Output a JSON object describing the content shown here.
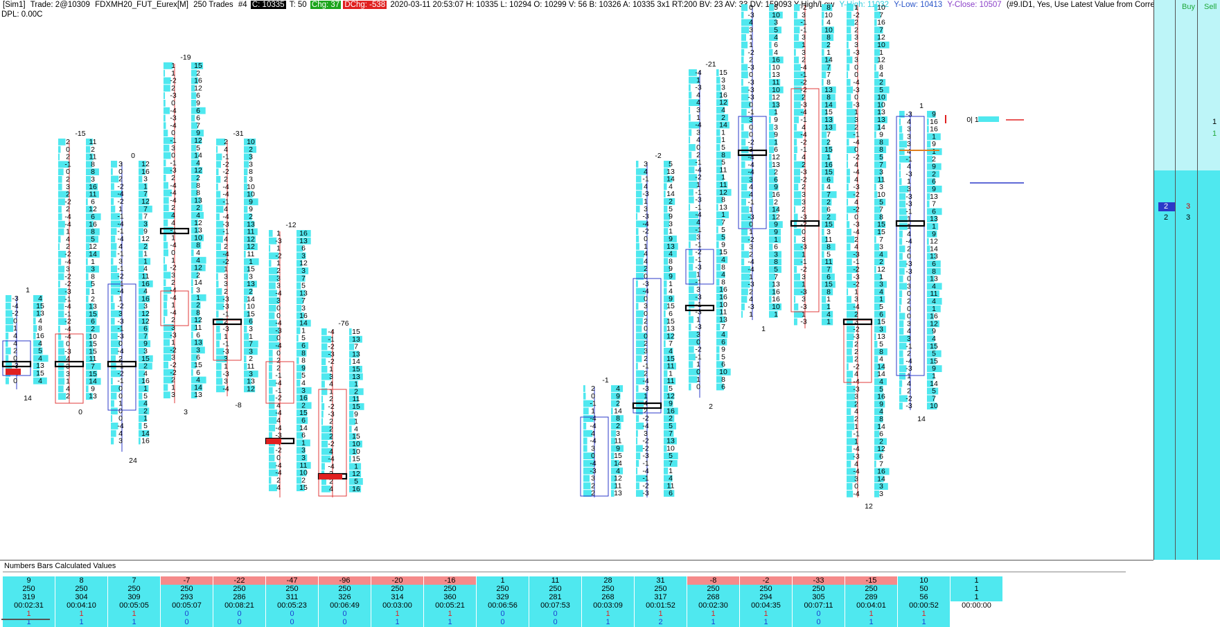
{
  "info_bar": {
    "account": "[Sim1]",
    "trade": "Trade: 2@10309",
    "symbol": "FDXMH20_FUT_Eurex[M]",
    "bar_type": "250 Trades",
    "instance": "#4",
    "close": "C: 10335",
    "trades": "T: 50",
    "change": "Chg: 37",
    "daily_change": "DChg: -538",
    "stats": "2020-03-11 20:53:07 H: 10335 L: 10294 O: 10299 V: 56 B: 10326 A: 10335 3x1 RT:200 BV: 23 AV: 33 DV: 159093 Y-High/Low",
    "y_high": "Y-High: 11032",
    "y_low": "Y-Low: 10413",
    "y_close": "Y-Close: 10507",
    "study_note": "(#9.ID1, Yes, Use Latest Value from Corresponding T"
  },
  "dpl": "DPL: 0.00C",
  "colors": {
    "bid_ask_bar": "#4fe8ef",
    "down_box": "#e23b3b",
    "up_box": "#2b39c8",
    "poc_outline": "#000000",
    "neg_row_bg": "#f58a8a",
    "pos_row_bg": "#4fe8ef"
  },
  "side_panel": {
    "headers": [
      "Buy",
      "Sell"
    ],
    "light_values": [
      {
        "col": 2,
        "text": "1"
      },
      {
        "col": 2,
        "text": "1"
      }
    ],
    "price_row": {
      "text1": "2",
      "text2": "3",
      "text3": "2",
      "text4": "3"
    },
    "open_label": "0| 1"
  },
  "candle_labels": {
    "top": [
      "1",
      "-15",
      "0",
      "-19",
      "-31",
      "-12",
      "-76",
      "-1",
      "-2",
      "-21",
      "1"
    ],
    "bottom": [
      "14",
      "0",
      "24",
      "3",
      "-8",
      "2",
      "1",
      "12",
      "14"
    ]
  },
  "bottom_panel": {
    "title": "Numbers Bars Calculated Values",
    "columns": [
      {
        "delta": "9",
        "trades": "250",
        "volume": "319",
        "time": "00:02:31",
        "r4": "1",
        "r5": "1"
      },
      {
        "delta": "8",
        "trades": "250",
        "volume": "304",
        "time": "00:04:10",
        "r4": "1",
        "r5": "1"
      },
      {
        "delta": "7",
        "trades": "250",
        "volume": "309",
        "time": "00:05:05",
        "r4": "1",
        "r5": "1"
      },
      {
        "delta": "-7",
        "trades": "250",
        "volume": "293",
        "time": "00:05:07",
        "r4": "0",
        "r5": "0"
      },
      {
        "delta": "-22",
        "trades": "250",
        "volume": "286",
        "time": "00:08:21",
        "r4": "0",
        "r5": "0"
      },
      {
        "delta": "-47",
        "trades": "250",
        "volume": "311",
        "time": "00:05:23",
        "r4": "0",
        "r5": "0"
      },
      {
        "delta": "-96",
        "trades": "250",
        "volume": "326",
        "time": "00:06:49",
        "r4": "0",
        "r5": "0"
      },
      {
        "delta": "-20",
        "trades": "250",
        "volume": "314",
        "time": "00:03:00",
        "r4": "1",
        "r5": "1"
      },
      {
        "delta": "-16",
        "trades": "250",
        "volume": "360",
        "time": "00:05:21",
        "r4": "1",
        "r5": "1"
      },
      {
        "delta": "1",
        "trades": "250",
        "volume": "329",
        "time": "00:06:56",
        "r4": "0",
        "r5": "0"
      },
      {
        "delta": "11",
        "trades": "250",
        "volume": "281",
        "time": "00:07:53",
        "r4": "0",
        "r5": "0"
      },
      {
        "delta": "28",
        "trades": "250",
        "volume": "268",
        "time": "00:03:09",
        "r4": "1",
        "r5": "1"
      },
      {
        "delta": "31",
        "trades": "250",
        "volume": "317",
        "time": "00:01:52",
        "r4": "1",
        "r5": "2"
      },
      {
        "delta": "-8",
        "trades": "250",
        "volume": "268",
        "time": "00:02:30",
        "r4": "1",
        "r5": "1"
      },
      {
        "delta": "-2",
        "trades": "250",
        "volume": "294",
        "time": "00:04:35",
        "r4": "1",
        "r5": "1"
      },
      {
        "delta": "-33",
        "trades": "250",
        "volume": "305",
        "time": "00:07:11",
        "r4": "0",
        "r5": "0"
      },
      {
        "delta": "-15",
        "trades": "250",
        "volume": "289",
        "time": "00:04:01",
        "r4": "1",
        "r5": "1"
      },
      {
        "delta": "10",
        "trades": "50",
        "volume": "56",
        "time": "00:00:52",
        "r4": "1",
        "r5": "1"
      },
      {
        "delta": "1",
        "trades": "1",
        "volume": "1",
        "time": "00:00:00",
        "r4": "",
        "r5": ""
      }
    ]
  },
  "chart_data": {
    "type": "table",
    "title": "",
    "bars": [
      {
        "label_top": "1",
        "label_bottom": "14",
        "delta": "9"
      },
      {
        "label_top": "-15",
        "label_bottom": "0",
        "delta": "8"
      },
      {
        "label_top": "0",
        "label_bottom": "24",
        "delta": "7"
      },
      {
        "label_top": "-19",
        "label_bottom": "3",
        "delta": "-7"
      },
      {
        "label_top": "-31",
        "label_bottom": "-8",
        "delta": "-22"
      },
      {
        "label_top": "-12",
        "label_bottom": "",
        "delta": "-47"
      },
      {
        "label_top": "-76",
        "label_bottom": "",
        "delta": "-96"
      },
      {
        "label_top": "",
        "label_bottom": "",
        "delta": "-20"
      },
      {
        "label_top": "",
        "label_bottom": "",
        "delta": "-16"
      },
      {
        "label_top": "",
        "label_bottom": "",
        "delta": "1"
      },
      {
        "label_top": "-1",
        "label_bottom": "",
        "delta": "11"
      },
      {
        "label_top": "-2",
        "label_bottom": "",
        "delta": "28"
      },
      {
        "label_top": "-21",
        "label_bottom": "12",
        "delta": "31"
      },
      {
        "label_top": "",
        "label_bottom": "2",
        "delta": "-8"
      },
      {
        "label_top": "",
        "label_bottom": "1",
        "delta": "-2"
      },
      {
        "label_top": "",
        "label_bottom": "",
        "delta": "-33"
      },
      {
        "label_top": "",
        "label_bottom": "",
        "delta": "-15"
      },
      {
        "label_top": "1",
        "label_bottom": "14",
        "delta": "10"
      }
    ]
  }
}
